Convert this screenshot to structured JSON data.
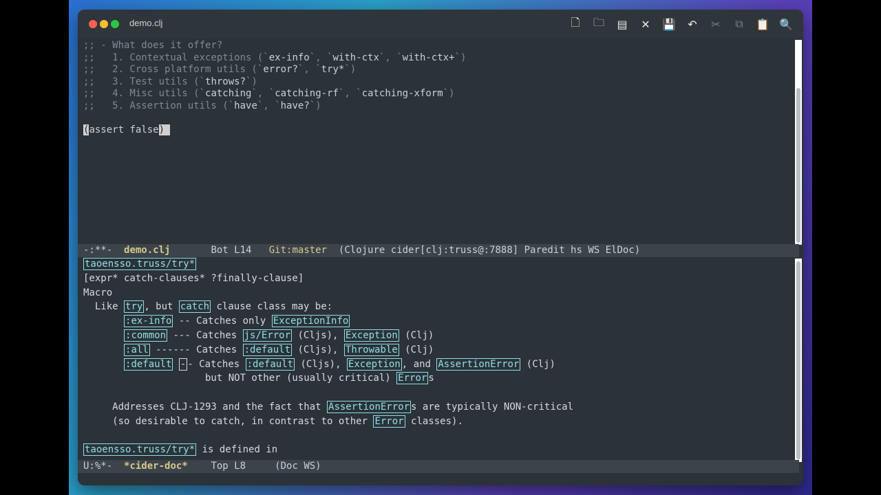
{
  "window": {
    "title": "demo.clj"
  },
  "toolbar": {
    "buttons": [
      {
        "name": "new-file",
        "glyph": "🗋"
      },
      {
        "name": "open-folder",
        "glyph": "🗀"
      },
      {
        "name": "dired",
        "glyph": "▤"
      },
      {
        "name": "close",
        "glyph": "✕"
      },
      {
        "name": "save",
        "glyph": "💾"
      },
      {
        "name": "undo",
        "glyph": "↶"
      },
      {
        "name": "cut",
        "glyph": "✂"
      },
      {
        "name": "copy",
        "glyph": "⧉"
      },
      {
        "name": "paste",
        "glyph": "📋"
      },
      {
        "name": "search",
        "glyph": "🔍"
      }
    ]
  },
  "editor": {
    "comment_lines": [
      ";; - What does it offer?",
      ";;   1. Contextual exceptions (`ex-info`, `with-ctx`, `with-ctx+`)",
      ";;   2. Cross platform utils (`error?`, `try*`)",
      ";;   3. Test utils (`throws?`)",
      ";;   4. Misc utils (`catching`, `catching-rf`, `catching-xform`)",
      ";;   5. Assertion utils (`have`, `have?`)"
    ],
    "assert_open": "(",
    "assert_body": "assert false",
    "assert_close": ")"
  },
  "modeline_top": {
    "status": "-:**-  ",
    "buffer": "demo.clj",
    "position": "       Bot L14   ",
    "git": "Git:master",
    "modes": "  (Clojure cider[clj:truss@:7888] Paredit hs WS ElDoc)"
  },
  "doc": {
    "symbol": "taoensso.truss/try*",
    "arglist": "[expr* catch-clauses* ?finally-clause]",
    "kind": "Macro",
    "l4_pre": "  Like ",
    "l4_try": "try",
    "l4_mid": ", but ",
    "l4_catch": "catch",
    "l4_post": " clause class may be:",
    "l5_pre": "       ",
    "l5_kw": ":ex-info",
    "l5_mid": " -- Catches only ",
    "l5_cls": "ExceptionInfo",
    "l6_pre": "       ",
    "l6_kw": ":common",
    "l6_mid": " --- Catches ",
    "l6_a": "js/Error",
    "l6_b": " (Cljs), ",
    "l6_c": "Exception",
    "l6_d": " (Clj)",
    "l7_pre": "       ",
    "l7_kw": ":all",
    "l7_mid": " ------ Catches ",
    "l7_a": ":default",
    "l7_b": " (Cljs), ",
    "l7_c": "Throwable",
    "l7_d": " (Clj)",
    "l8_pre": "       ",
    "l8_kw": ":default",
    "l8_sp": " ",
    "l8_cur": "-",
    "l8_mid": "- Catches ",
    "l8_a": ":default",
    "l8_b": " (Cljs), ",
    "l8_c": "Exception",
    "l8_d": ", and ",
    "l8_e": "AssertionError",
    "l8_f": " (Clj)",
    "l9_pre": "                     but NOT other (usually critical) ",
    "l9_cls": "Error",
    "l9_post": "s",
    "l11_pre": "     Addresses CLJ-1293 and the fact that ",
    "l11_cls": "AssertionError",
    "l11_post": "s are typically NON-critical",
    "l12_pre": "     (so desirable to catch, in contrast to other ",
    "l12_cls": "Error",
    "l12_post": " classes).",
    "l14_sym": "taoensso.truss/try*",
    "l14_post": " is defined in"
  },
  "modeline_bottom": {
    "status": "U:%*-  ",
    "buffer": "*cider-doc*",
    "position": "    Top L8     ",
    "modes": "(Doc WS)"
  }
}
